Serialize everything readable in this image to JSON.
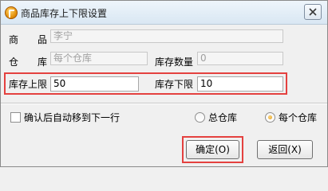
{
  "window": {
    "title": "商品库存上下限设置"
  },
  "form": {
    "product_label": "商　　品",
    "product_value": "李宁",
    "warehouse_label": "仓　　库",
    "warehouse_value": "每个仓库",
    "stock_qty_label": "库存数量",
    "stock_qty_value": "0",
    "upper_label": "库存上限",
    "upper_value": "50",
    "lower_label": "库存下限",
    "lower_value": "10"
  },
  "options": {
    "auto_next_label": "确认后自动移到下一行",
    "auto_next_checked": false,
    "radio_total_label": "总仓库",
    "radio_each_label": "每个仓库",
    "selected": "每个仓库"
  },
  "buttons": {
    "ok_label": "确定(O)",
    "back_label": "返回(X)"
  },
  "colors": {
    "highlight": "#e4413f"
  }
}
